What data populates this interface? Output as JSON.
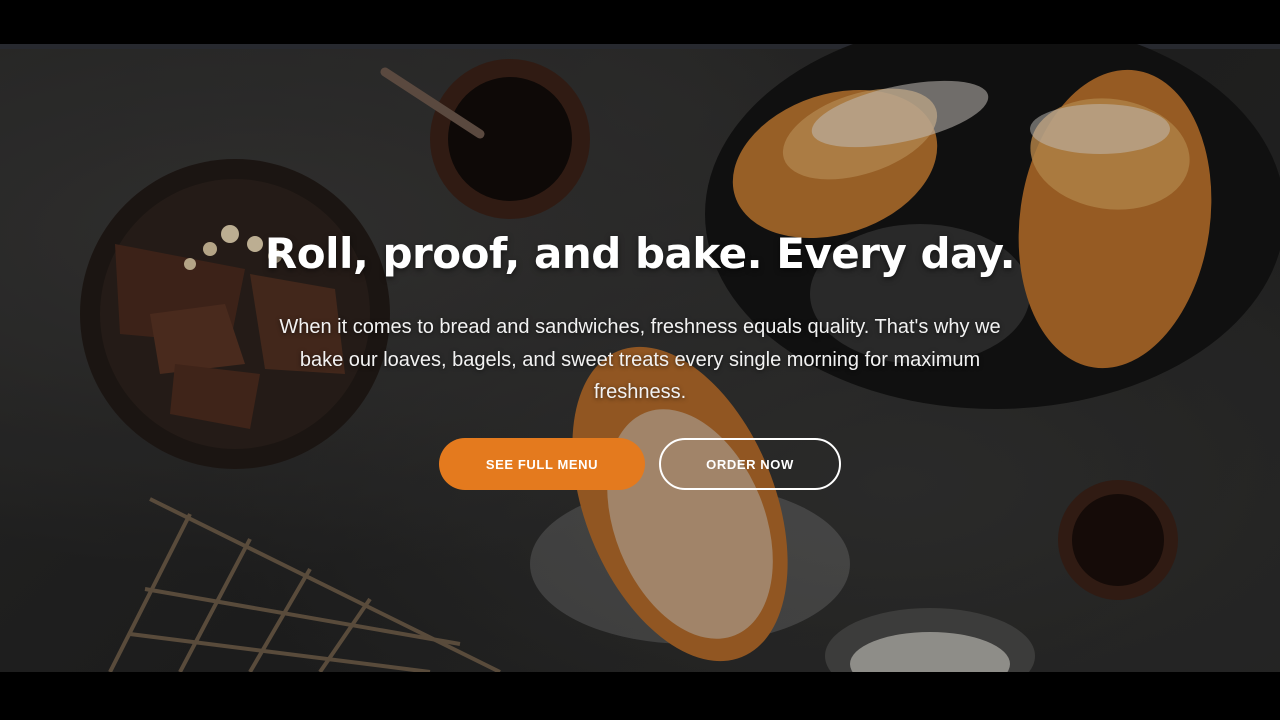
{
  "hero": {
    "headline": "Roll, proof, and bake. Every day.",
    "subtext": "When it comes to bread and sandwiches, freshness equals quality. That's why we bake our loaves, bagels, and sweet treats every single morning for maximum freshness.",
    "primary_button": "SEE FULL MENU",
    "secondary_button": "ORDER NOW"
  },
  "colors": {
    "accent": "#e47a1e",
    "background": "#262626",
    "text": "#ffffff"
  }
}
